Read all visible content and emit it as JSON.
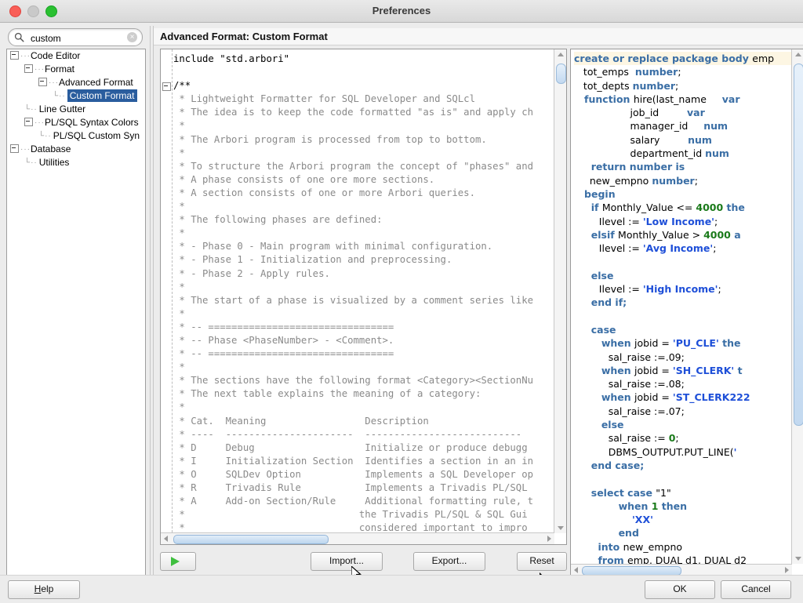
{
  "window": {
    "title": "Preferences",
    "traffic_lights": [
      "close-red",
      "minimize-gray",
      "zoom-green"
    ]
  },
  "sidebar": {
    "search": {
      "value": "custom",
      "placeholder": "Search",
      "icon": "search-icon",
      "clear_icon": "×"
    },
    "tree": [
      {
        "label": "Code Editor",
        "depth": 0,
        "expandable": true,
        "selected": false
      },
      {
        "label": "Format",
        "depth": 1,
        "expandable": true,
        "selected": false
      },
      {
        "label": "Advanced Format",
        "depth": 2,
        "expandable": true,
        "selected": false
      },
      {
        "label": "Custom Format",
        "depth": 3,
        "expandable": false,
        "selected": true
      },
      {
        "label": "Line Gutter",
        "depth": 1,
        "expandable": false,
        "selected": false
      },
      {
        "label": "PL/SQL Syntax Colors",
        "depth": 1,
        "expandable": true,
        "selected": false
      },
      {
        "label": "PL/SQL Custom Syn",
        "depth": 2,
        "expandable": false,
        "selected": false
      },
      {
        "label": "Database",
        "depth": 0,
        "expandable": true,
        "selected": false
      },
      {
        "label": "Utilities",
        "depth": 1,
        "expandable": false,
        "selected": false
      }
    ]
  },
  "panel": {
    "header": "Advanced Format: Custom Format"
  },
  "editor_left": {
    "lines": [
      {
        "t": "include \"std.arbori\"",
        "dark": true
      },
      {
        "t": ""
      },
      {
        "t": "/**",
        "fold": true,
        "dark": true
      },
      {
        "t": " * Lightweight Formatter for SQL Developer and SQLcl"
      },
      {
        "t": " * The idea is to keep the code formatted \"as is\" and apply ch"
      },
      {
        "t": " *"
      },
      {
        "t": " * The Arbori program is processed from top to bottom."
      },
      {
        "t": " *"
      },
      {
        "t": " * To structure the Arbori program the concept of \"phases\" and"
      },
      {
        "t": " * A phase consists of one ore more sections."
      },
      {
        "t": " * A section consists of one or more Arbori queries."
      },
      {
        "t": " *"
      },
      {
        "t": " * The following phases are defined:"
      },
      {
        "t": " *"
      },
      {
        "t": " * - Phase 0 - Main program with minimal configuration."
      },
      {
        "t": " * - Phase 1 - Initialization and preprocessing."
      },
      {
        "t": " * - Phase 2 - Apply rules."
      },
      {
        "t": " *"
      },
      {
        "t": " * The start of a phase is visualized by a comment series like"
      },
      {
        "t": " *"
      },
      {
        "t": " * -- ================================"
      },
      {
        "t": " * -- Phase <PhaseNumber> - <Comment>."
      },
      {
        "t": " * -- ================================"
      },
      {
        "t": " *"
      },
      {
        "t": " * The sections have the following format <Category><SectionNu"
      },
      {
        "t": " * The next table explains the meaning of a category:"
      },
      {
        "t": " *"
      },
      {
        "t": " * Cat.  Meaning                 Description"
      },
      {
        "t": " * ----  ----------------------  ---------------------------"
      },
      {
        "t": " * D     Debug                   Initialize or produce debugg"
      },
      {
        "t": " * I     Initialization Section  Identifies a section in an in"
      },
      {
        "t": " * O     SQLDev Option           Implements a SQL Developer op"
      },
      {
        "t": " * R     Trivadis Rule           Implements a Trivadis PL/SQL "
      },
      {
        "t": " * A     Add-on Section/Rule     Additional formatting rule, t"
      },
      {
        "t": " *                              the Trivadis PL/SQL & SQL Gui"
      },
      {
        "t": " *                              considered important to impro"
      },
      {
        "t": " *"
      }
    ]
  },
  "editor_right": {
    "lines": [
      [
        {
          "c": "kw",
          "t": "create or replace package body "
        },
        {
          "c": "id",
          "t": "emp"
        }
      ],
      [
        {
          "c": "id",
          "t": "   tot_emps  "
        },
        {
          "c": "kw",
          "t": "number"
        },
        {
          "c": "id",
          "t": ";"
        }
      ],
      [
        {
          "c": "id",
          "t": "   tot_depts "
        },
        {
          "c": "kw",
          "t": "number"
        },
        {
          "c": "id",
          "t": ";"
        }
      ],
      [
        {
          "c": "kw",
          "t": "   function "
        },
        {
          "c": "id",
          "t": "hire(last_name     "
        },
        {
          "c": "kw",
          "t": "var"
        }
      ],
      [
        {
          "c": "id",
          "t": "                  job_id         "
        },
        {
          "c": "kw",
          "t": "var"
        }
      ],
      [
        {
          "c": "id",
          "t": "                  manager_id     "
        },
        {
          "c": "kw",
          "t": "num"
        }
      ],
      [
        {
          "c": "id",
          "t": "                  salary         "
        },
        {
          "c": "kw",
          "t": "num"
        }
      ],
      [
        {
          "c": "id",
          "t": "                  department_id "
        },
        {
          "c": "kw",
          "t": "num"
        }
      ],
      [
        {
          "c": "kw",
          "t": "     return number is"
        }
      ],
      [
        {
          "c": "id",
          "t": "     new_empno "
        },
        {
          "c": "kw",
          "t": "number"
        },
        {
          "c": "id",
          "t": ";"
        }
      ],
      [
        {
          "c": "kw",
          "t": "   begin"
        }
      ],
      [
        {
          "c": "kw",
          "t": "     if "
        },
        {
          "c": "id",
          "t": "Monthly_Value <= "
        },
        {
          "c": "nm",
          "t": "4000"
        },
        {
          "c": "kw",
          "t": " the"
        }
      ],
      [
        {
          "c": "id",
          "t": "        Ilevel := "
        },
        {
          "c": "st",
          "t": "'Low Income'"
        },
        {
          "c": "id",
          "t": ";"
        }
      ],
      [
        {
          "c": "kw",
          "t": "     elsif "
        },
        {
          "c": "id",
          "t": "Monthly_Value > "
        },
        {
          "c": "nm",
          "t": "4000"
        },
        {
          "c": "kw",
          "t": " a"
        }
      ],
      [
        {
          "c": "id",
          "t": "        Ilevel := "
        },
        {
          "c": "st",
          "t": "'Avg Income'"
        },
        {
          "c": "id",
          "t": ";"
        }
      ],
      [
        {
          "c": "id",
          "t": ""
        }
      ],
      [
        {
          "c": "kw",
          "t": "     else"
        }
      ],
      [
        {
          "c": "id",
          "t": "        Ilevel := "
        },
        {
          "c": "st",
          "t": "'High Income'"
        },
        {
          "c": "id",
          "t": ";"
        }
      ],
      [
        {
          "c": "kw",
          "t": "     end if;"
        }
      ],
      [
        {
          "c": "id",
          "t": ""
        }
      ],
      [
        {
          "c": "kw",
          "t": "     case"
        }
      ],
      [
        {
          "c": "kw",
          "t": "        when "
        },
        {
          "c": "id",
          "t": "jobid = "
        },
        {
          "c": "st",
          "t": "'PU_CLE'"
        },
        {
          "c": "kw",
          "t": " the"
        }
      ],
      [
        {
          "c": "id",
          "t": "           sal_raise :=.09;"
        }
      ],
      [
        {
          "c": "kw",
          "t": "        when "
        },
        {
          "c": "id",
          "t": "jobid = "
        },
        {
          "c": "st",
          "t": "'SH_CLERK'"
        },
        {
          "c": "kw",
          "t": " t"
        }
      ],
      [
        {
          "c": "id",
          "t": "           sal_raise :=.08;"
        }
      ],
      [
        {
          "c": "kw",
          "t": "        when "
        },
        {
          "c": "id",
          "t": "jobid = "
        },
        {
          "c": "st",
          "t": "'ST_CLERK222"
        }
      ],
      [
        {
          "c": "id",
          "t": "           sal_raise :=.07;"
        }
      ],
      [
        {
          "c": "kw",
          "t": "        else"
        }
      ],
      [
        {
          "c": "id",
          "t": "           sal_raise := "
        },
        {
          "c": "nm",
          "t": "0"
        },
        {
          "c": "id",
          "t": ";"
        }
      ],
      [
        {
          "c": "id",
          "t": "           DBMS_OUTPUT.PUT_LINE("
        },
        {
          "c": "st",
          "t": "'"
        }
      ],
      [
        {
          "c": "kw",
          "t": "     end case;"
        }
      ],
      [
        {
          "c": "id",
          "t": ""
        }
      ],
      [
        {
          "c": "kw",
          "t": "     select case "
        },
        {
          "c": "id",
          "t": "\"1\""
        }
      ],
      [
        {
          "c": "kw",
          "t": "             when "
        },
        {
          "c": "nm",
          "t": "1"
        },
        {
          "c": "kw",
          "t": " then"
        }
      ],
      [
        {
          "c": "st",
          "t": "                 'XX'"
        }
      ],
      [
        {
          "c": "kw",
          "t": "             end"
        }
      ],
      [
        {
          "c": "kw",
          "t": "       into "
        },
        {
          "c": "id",
          "t": "new_empno"
        }
      ],
      [
        {
          "c": "kw",
          "t": "       from "
        },
        {
          "c": "id",
          "t": "emp, DUAL d1, DUAL d2"
        }
      ]
    ]
  },
  "toolbar": {
    "run_label": "",
    "run_icon": "play-icon",
    "import_label": "Import...",
    "export_label": "Export...",
    "reset_label": "Reset"
  },
  "footer": {
    "help_label": "Help",
    "help_mnemonic": "H",
    "ok_label": "OK",
    "cancel_label": "Cancel"
  },
  "colors": {
    "selection": "#2a5d9e",
    "keyword": "#3a6ea5",
    "string": "#1e4fd8",
    "number": "#1a7a1a",
    "comment": "#8a8a8a",
    "window_bg": "#ececec"
  }
}
